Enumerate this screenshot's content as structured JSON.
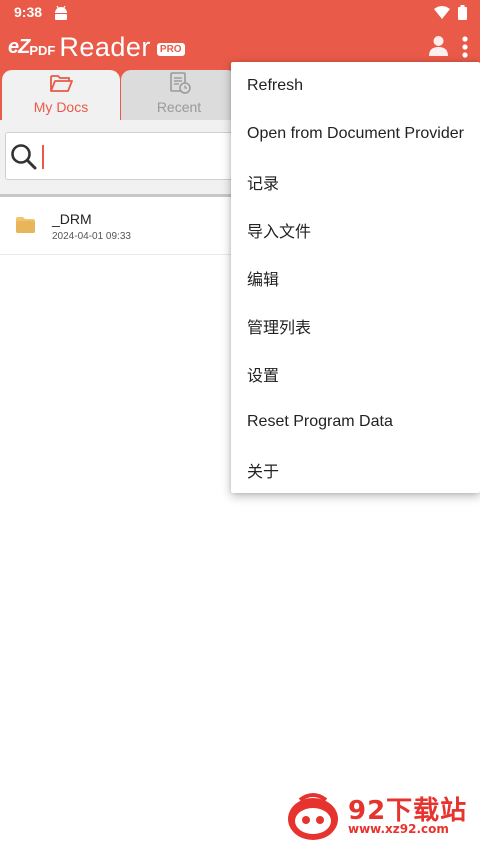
{
  "status_bar": {
    "time": "9:38",
    "icons": [
      "android-icon",
      "wifi-icon",
      "battery-icon"
    ]
  },
  "app_bar": {
    "logo": {
      "ez": "eZ",
      "pdf": "PDF",
      "reader": "Reader",
      "badge": "PRO"
    },
    "icons": [
      "account-icon",
      "overflow-menu-icon"
    ],
    "color": "#e95a48"
  },
  "tabs": [
    {
      "label": "My Docs",
      "icon": "folder-open-icon",
      "active": true
    },
    {
      "label": "Recent",
      "icon": "recent-document-icon",
      "active": false
    }
  ],
  "search": {
    "value": "",
    "placeholder": "",
    "icon": "search-icon"
  },
  "files": [
    {
      "name": "_DRM",
      "date": "2024-04-01 09:33",
      "icon": "folder-icon"
    }
  ],
  "menu": {
    "items": [
      "Refresh",
      "Open from Document Provider",
      "记录",
      "导入文件",
      "编辑",
      "管理列表",
      "设置",
      "Reset Program Data",
      "关于"
    ]
  },
  "watermark": {
    "title": "92下载站",
    "url": "www.xz92.com",
    "color": "#e7332e"
  }
}
